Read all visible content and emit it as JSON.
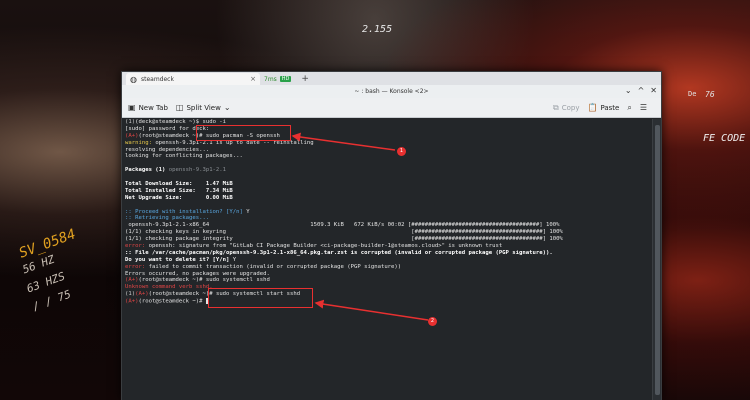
{
  "wallpaper": {
    "texts": [
      "SV_0584",
      "56 HZ",
      "63 HZS",
      "/ / 75",
      "2.155",
      "FE CODE",
      "De",
      "76"
    ]
  },
  "browser": {
    "tab_label": "steamdeck",
    "tab_close": "×",
    "status_ms": "7ms",
    "status_badge": "HD",
    "new_tab": "+"
  },
  "window": {
    "title": "~ : bash — Konsole <2>",
    "controls": [
      "⌄",
      "^",
      "✕"
    ]
  },
  "toolbar": {
    "new_tab_label": "New Tab",
    "split_view_label": "Split View",
    "copy_label": "Copy",
    "paste_label": "Paste",
    "search_icon": "search-icon",
    "menu_icon": "hamburger-icon"
  },
  "terminal": {
    "lines": [
      {
        "segs": [
          [
            "(1)",
            "c-bracket"
          ],
          [
            "(deck@steamdeck ~)$ sudo -i",
            ""
          ]
        ]
      },
      {
        "segs": [
          [
            "[sudo] password for deck:",
            ""
          ]
        ]
      },
      {
        "segs": [
          [
            "(A+)",
            "c-red"
          ],
          [
            "(root@steamdeck ~)# sudo pacman -S openssh",
            ""
          ]
        ]
      },
      {
        "segs": [
          [
            "warning: ",
            "c-yellow"
          ],
          [
            "openssh-9.3p1-2.1 is up to date -- reinstalling",
            ""
          ]
        ]
      },
      {
        "segs": [
          [
            "resolving dependencies...",
            ""
          ]
        ]
      },
      {
        "segs": [
          [
            "looking for conflicting packages...",
            ""
          ]
        ]
      },
      {
        "segs": [
          [
            "",
            ""
          ]
        ]
      },
      {
        "segs": [
          [
            "Packages (1) ",
            "c-white"
          ],
          [
            "openssh-9.3p1-2.1",
            "c-dim"
          ]
        ]
      },
      {
        "segs": [
          [
            "",
            ""
          ]
        ]
      },
      {
        "segs": [
          [
            "Total Download Size:    1.47 MiB",
            "c-white"
          ]
        ]
      },
      {
        "segs": [
          [
            "Total Installed Size:   7.34 MiB",
            "c-white"
          ]
        ]
      },
      {
        "segs": [
          [
            "Net Upgrade Size:       0.00 MiB",
            "c-white"
          ]
        ]
      },
      {
        "segs": [
          [
            "",
            ""
          ]
        ]
      },
      {
        "segs": [
          [
            ":: Proceed with installation? [Y/n] ",
            "c-blue"
          ],
          [
            "Y",
            ""
          ]
        ]
      },
      {
        "segs": [
          [
            ":: Retrieving packages...",
            "c-blue"
          ]
        ]
      },
      {
        "segs": [
          [
            " openssh-9.3p1-2.1-x86_64                              1509.3 KiB   672 KiB/s 00:02 [######################################] 100%",
            ""
          ]
        ]
      },
      {
        "segs": [
          [
            "(1/1) checking keys in keyring                                                       [######################################] 100%",
            ""
          ]
        ]
      },
      {
        "segs": [
          [
            "(1/1) checking package integrity                                                     [######################################] 100%",
            ""
          ]
        ]
      },
      {
        "segs": [
          [
            "error: ",
            "c-red"
          ],
          [
            "openssh: signature from \"GitLab CI Package Builder <ci-package-builder-1@steamos.cloud>\" is unknown trust",
            ""
          ]
        ]
      },
      {
        "segs": [
          [
            ":: File /var/cache/pacman/pkg/openssh-9.3p1-2.1-x86_64.pkg.tar.zst is corrupted (invalid or corrupted package (PGP signature)).",
            "c-white"
          ]
        ]
      },
      {
        "segs": [
          [
            "Do you want to delete it? [Y/n] ",
            "c-white"
          ],
          [
            "Y",
            ""
          ]
        ]
      },
      {
        "segs": [
          [
            "error: ",
            "c-red"
          ],
          [
            "failed to commit transaction (invalid or corrupted package (PGP signature))",
            ""
          ]
        ]
      },
      {
        "segs": [
          [
            "Errors occurred, no packages were upgraded.",
            ""
          ]
        ]
      },
      {
        "segs": [
          [
            "(A+)",
            "c-red"
          ],
          [
            "(root@steamdeck ~)# sudo systemctl sshd",
            ""
          ]
        ]
      },
      {
        "segs": [
          [
            "Unknown command verb sshd.",
            "c-red"
          ]
        ]
      },
      {
        "segs": [
          [
            "(1)",
            "c-bracket"
          ],
          [
            "(A+)",
            "c-red"
          ],
          [
            "(root@steamdeck ~)# sudo systemctl start sshd",
            ""
          ]
        ]
      },
      {
        "segs": [
          [
            "(A+)",
            "c-red"
          ],
          [
            "(root@steamdeck ~)# ",
            ""
          ]
        ],
        "cursor": true
      }
    ]
  },
  "annotations": {
    "markers": [
      "1",
      "2"
    ],
    "arrow_color": "#e83030"
  }
}
